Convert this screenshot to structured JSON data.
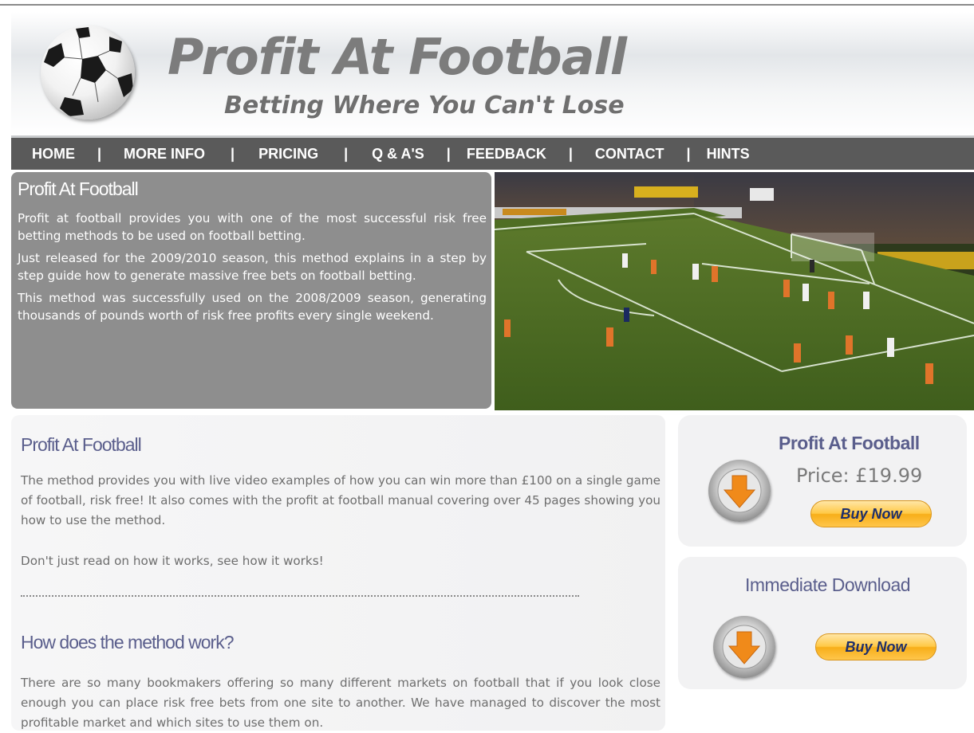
{
  "header": {
    "title": "Profit At Football",
    "tagline": "Betting Where You Can't Lose",
    "logo_icon": "soccer-ball-icon"
  },
  "nav": {
    "items": [
      "HOME",
      "MORE INFO",
      "PRICING",
      "Q & A'S",
      "FEEDBACK",
      "CONTACT",
      "HINTS"
    ],
    "separator": "|"
  },
  "intro": {
    "title": "Profit At Football",
    "paragraphs": [
      "Profit at football provides you with one of the most successful risk free betting methods to be used on football betting.",
      "Just released for the 2009/2010 season, this method explains in a step by step guide how to generate massive free bets on football betting.",
      "This method was successfully used on the 2008/2009 season, generating thousands of pounds worth of risk free profits every single weekend."
    ]
  },
  "main": {
    "section1_title": "Profit At Football",
    "section1_p1": "The method provides you with live video examples of how you can win more than £100 on a single game of football, risk free! It also comes with the profit at football manual covering over 45 pages showing you how to use the method.",
    "section1_p2": "Don't just read on how it works, see how it works!",
    "section2_title": "How does the method work?",
    "section2_p1": "There are so many bookmakers offering so many different markets on football that if you look close enough you can place risk free bets from one site to another. We have managed to discover the most profitable market and which sites to use them on."
  },
  "sidebar": {
    "box1": {
      "title": "Profit At Football",
      "price": "Price: £19.99",
      "button": "Buy Now",
      "icon": "download-arrow-icon"
    },
    "box2": {
      "title": "Immediate Download",
      "button": "Buy Now",
      "icon": "download-arrow-icon"
    }
  },
  "colors": {
    "nav_bg": "#5a5a5a",
    "intro_bg": "#8e8e8e",
    "heading": "#5a5e8c",
    "button": "#ffc845"
  }
}
